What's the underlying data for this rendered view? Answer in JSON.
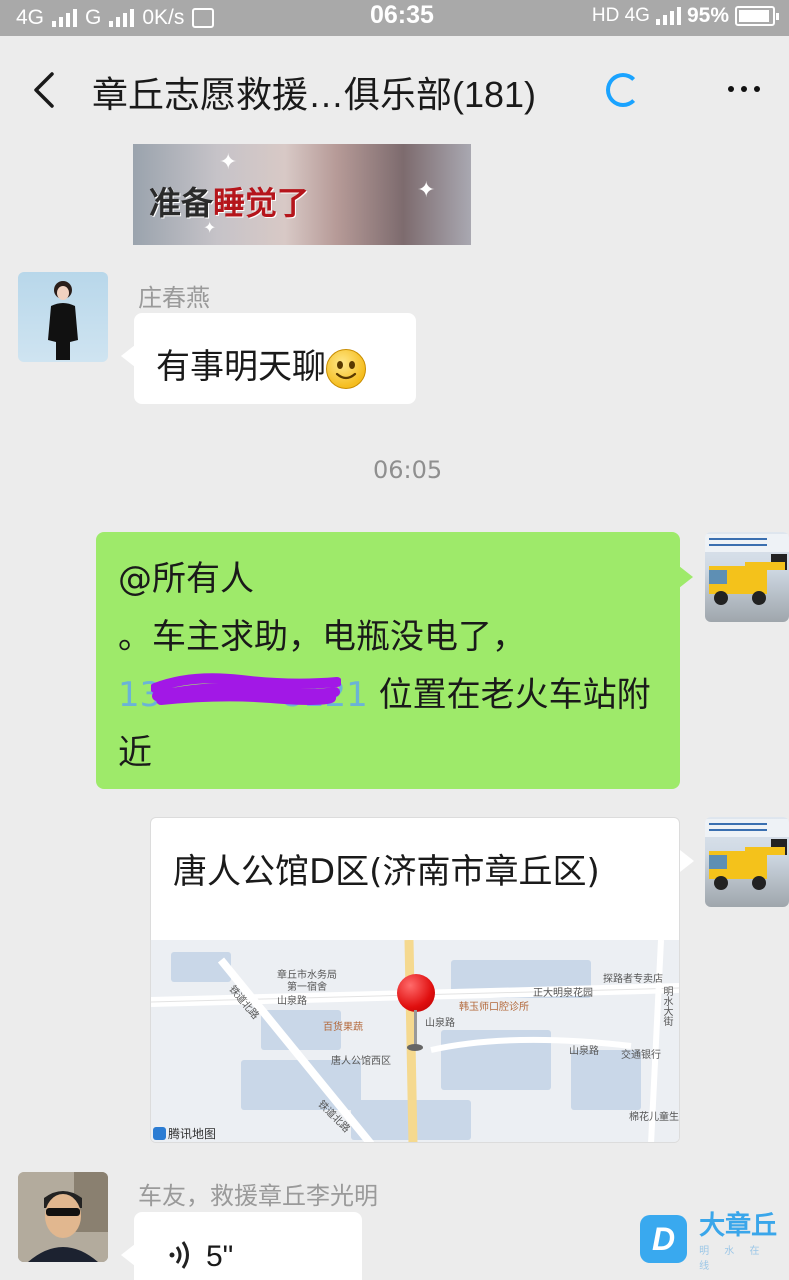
{
  "status_bar": {
    "left_network_1": "4G",
    "left_network_2": "G",
    "speed": "0K/s",
    "time": "06:35",
    "right_network": "HD 4G",
    "battery_percent": "95%",
    "battery_level": 0.95
  },
  "header": {
    "title": "章丘志愿救援…俱乐部(181)"
  },
  "messages": {
    "sticker": {
      "text_dark": "准备",
      "text_red": "睡觉了"
    },
    "msg1": {
      "sender": "庄春燕",
      "text": "有事明天聊"
    },
    "timestamp": "06:05",
    "msg2": {
      "line1": "@所有人",
      "line2": "。车主求助，电瓶没电了，",
      "phone_start": "13",
      "phone_end": "8121",
      "line3_rest": " 位置在老火车站附",
      "line4": "近"
    },
    "location": {
      "title": "唐人公馆D区(济南市章丘区)",
      "map_labels": {
        "l1": "章丘市水务局",
        "l2": "第一宿舍",
        "l3": "探路者专卖店",
        "l4": "正大明泉花园",
        "l5": "山泉路",
        "l6": "韩玉师口腔诊所",
        "l7": "山泉路",
        "l8": "百货果蔬",
        "l9": "唐人公馆西区",
        "l10": "山泉路",
        "l11": "交通银行",
        "l12": "铁道北路",
        "l13": "铁道北路",
        "l14": "明水大街",
        "l15": "棉花儿童生活"
      },
      "map_provider": "腾讯地图"
    },
    "msg3": {
      "sender": "车友，救援章丘李光明",
      "duration": "5\""
    }
  },
  "watermark": {
    "logo_letter": "D",
    "text": "大章丘",
    "sub": "明 水 在 线"
  }
}
